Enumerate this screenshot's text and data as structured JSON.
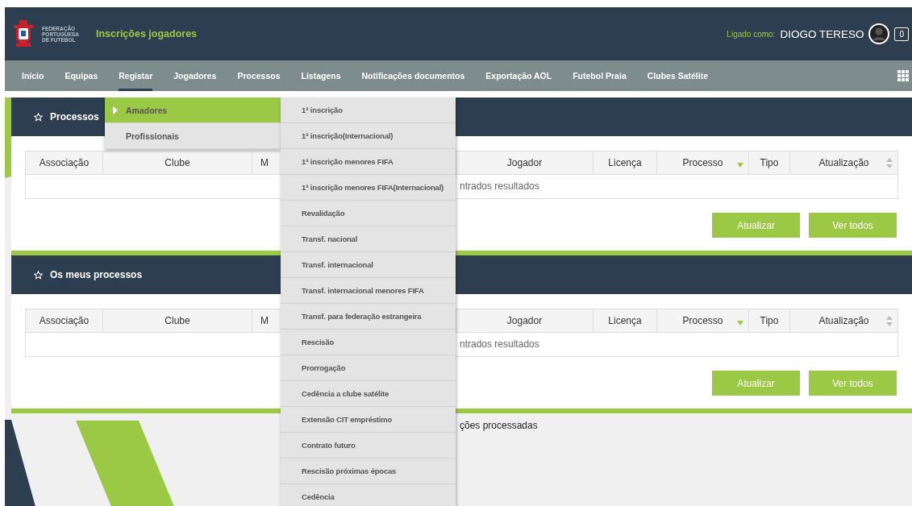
{
  "header": {
    "org_name": [
      "FEDERAÇÃO",
      "PORTUGUESA",
      "DE FUTEBOL"
    ],
    "app_title": "Inscrições jogadores",
    "logged_label": "Ligado como:",
    "user_name": "DIOGO TERESO",
    "notification_count": "0"
  },
  "nav": [
    {
      "label": "Início",
      "selected": false
    },
    {
      "label": "Equipas",
      "selected": false
    },
    {
      "label": "Registar",
      "selected": true
    },
    {
      "label": "Jogadores",
      "selected": false
    },
    {
      "label": "Processos",
      "selected": false
    },
    {
      "label": "Listagens",
      "selected": false
    },
    {
      "label": "Notificações documentos",
      "selected": false
    },
    {
      "label": "Exportação AOL",
      "selected": false
    },
    {
      "label": "Futebol Praia",
      "selected": false
    },
    {
      "label": "Clubes Satélite",
      "selected": false
    }
  ],
  "dropdown": {
    "items": [
      {
        "label": "Amadores",
        "selected": true
      },
      {
        "label": "Profissionais",
        "selected": false
      }
    ],
    "submenu": [
      "1ª inscrição",
      "1ª inscrição(Internacional)",
      "1ª inscrição menores FIFA",
      "1ª inscrição menores FIFA(Internacional)",
      "Revalidação",
      "Transf. nacional",
      "Transf. internacional",
      "Transf. internacional menores FIFA",
      "Transf. para federação estrangeira",
      "Rescisão",
      "Prorrogação",
      "Cedência a clube satélite",
      "Extensão CIT empréstimo",
      "Contrato futuro",
      "Rescisão próximas épocas",
      "Cedência"
    ]
  },
  "panels": [
    {
      "title": "Processos",
      "columns": [
        {
          "label": "Associação",
          "kind": "plain"
        },
        {
          "label": "Clube",
          "kind": "plain"
        },
        {
          "label": "M",
          "kind": "plain"
        },
        {
          "label": "Jogador",
          "kind": "plain"
        },
        {
          "label": "Licença",
          "kind": "plain"
        },
        {
          "label": "Processo",
          "kind": "sorted"
        },
        {
          "label": "Tipo",
          "kind": "plain"
        },
        {
          "label": "Atualização",
          "kind": "sortable"
        }
      ],
      "empty_text": "ntrados resultados",
      "buttons": [
        "Atualizar",
        "Ver todos"
      ]
    },
    {
      "title": "Os meus processos",
      "columns": [
        {
          "label": "Associação",
          "kind": "plain"
        },
        {
          "label": "Clube",
          "kind": "plain"
        },
        {
          "label": "M",
          "kind": "plain"
        },
        {
          "label": "Jogador",
          "kind": "plain"
        },
        {
          "label": "Licença",
          "kind": "plain"
        },
        {
          "label": "Processo",
          "kind": "sorted"
        },
        {
          "label": "Tipo",
          "kind": "plain"
        },
        {
          "label": "Atualização",
          "kind": "sortable"
        }
      ],
      "empty_text": "ntrados resultados",
      "buttons": [
        "Atualizar",
        "Ver todos"
      ]
    }
  ],
  "footer_text": "ções processadas"
}
